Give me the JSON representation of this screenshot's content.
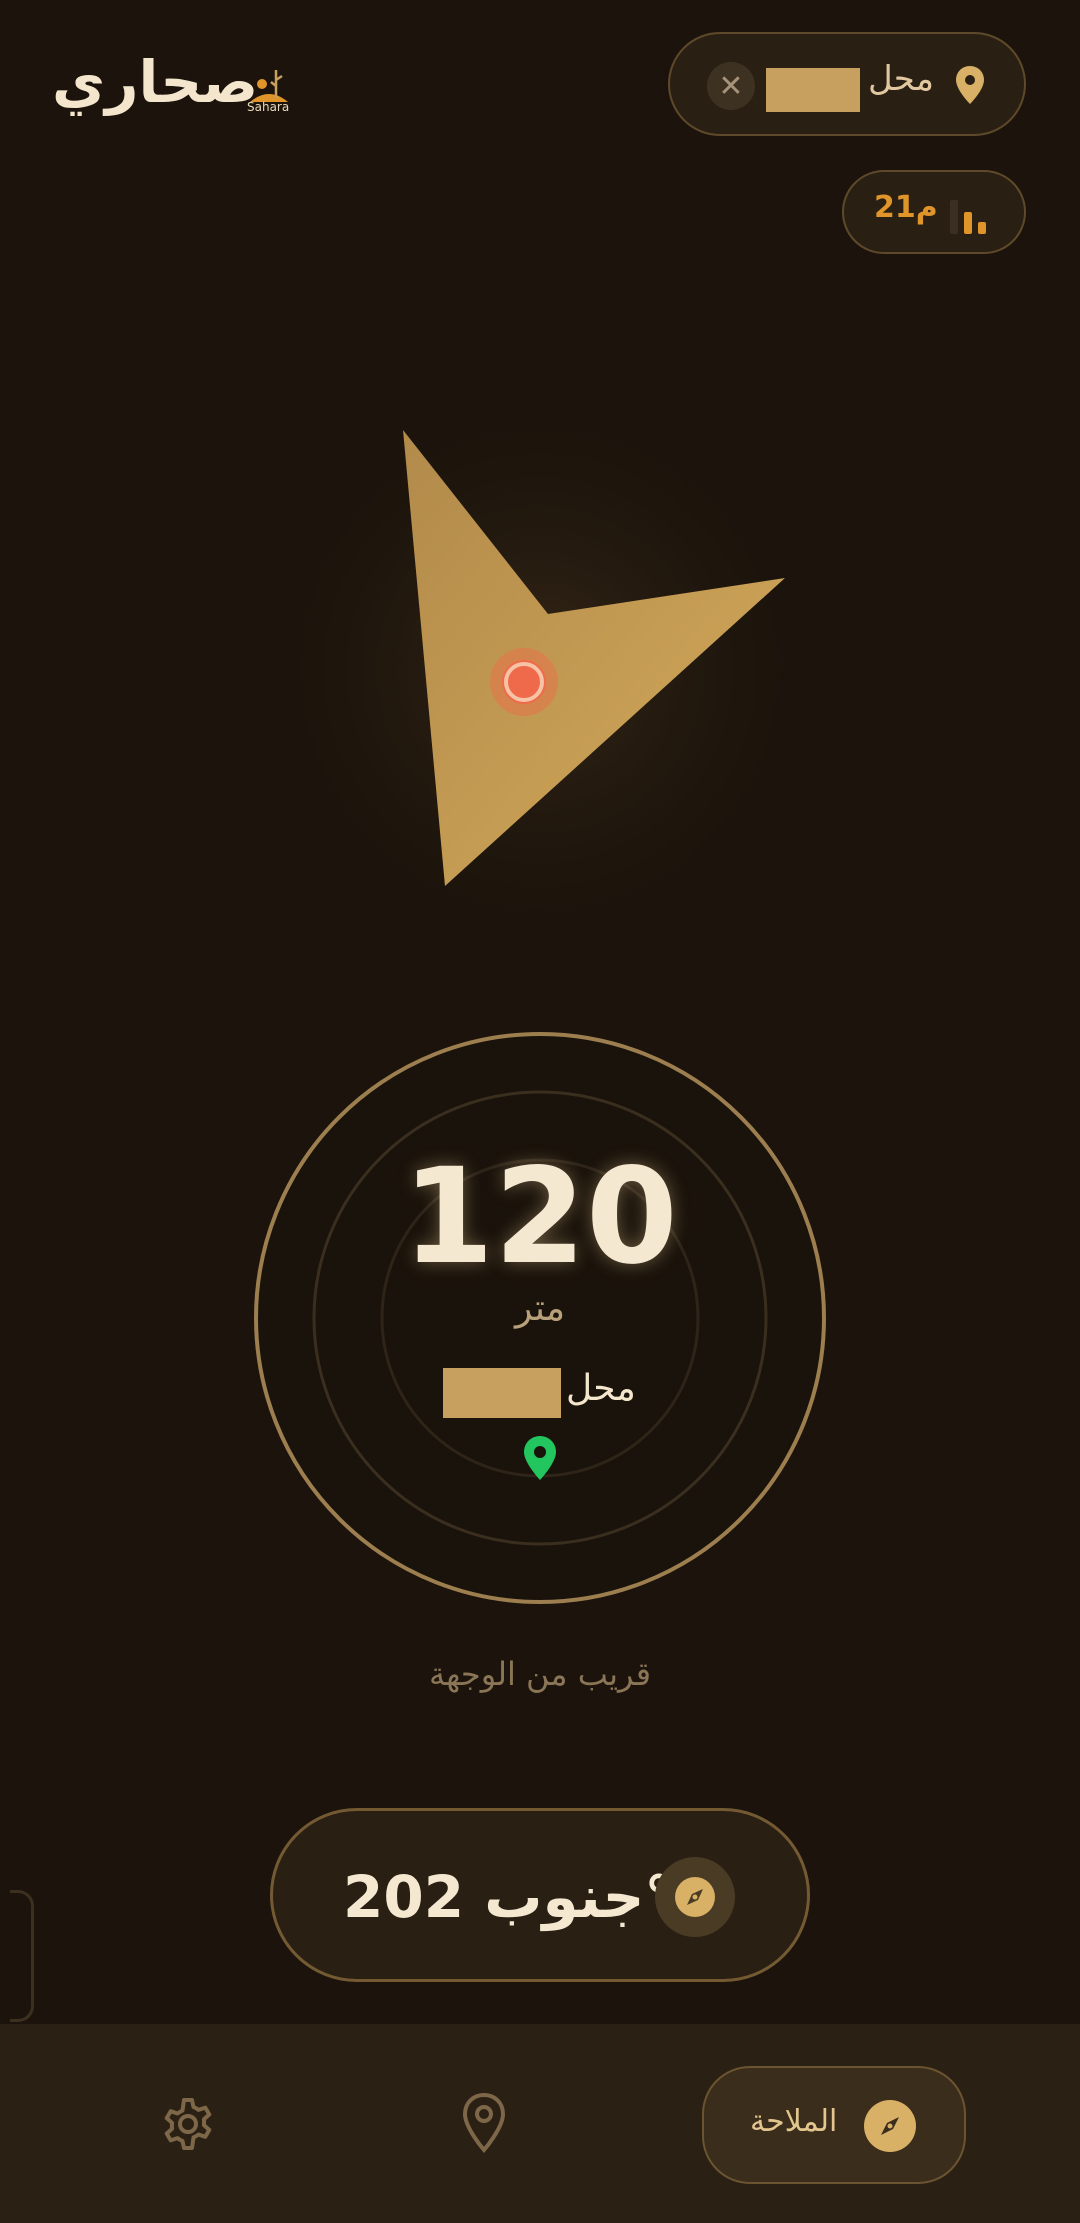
{
  "header": {
    "app_title": "صحاري",
    "logo_text": "Sahara",
    "place_label": "محل",
    "close_glyph": "✕",
    "accuracy": "21م"
  },
  "distance": {
    "value": "120",
    "unit": "متر",
    "destination_label": "محل",
    "status": "قريب من الوجهة"
  },
  "heading": {
    "text": "جنوب 202°"
  },
  "nav": {
    "items": [
      {
        "label": "الملاحة",
        "icon": "compass-icon",
        "active": true
      },
      {
        "label": "",
        "icon": "location-pin-icon",
        "active": false
      },
      {
        "label": "",
        "icon": "gear-icon",
        "active": false
      }
    ]
  },
  "colors": {
    "background": "#1c140c",
    "accent_gold": "#c7a05f",
    "accent_orange": "#e0952a",
    "destination_pin": "#22c55e",
    "arrow_center": "#ef6a4a"
  }
}
